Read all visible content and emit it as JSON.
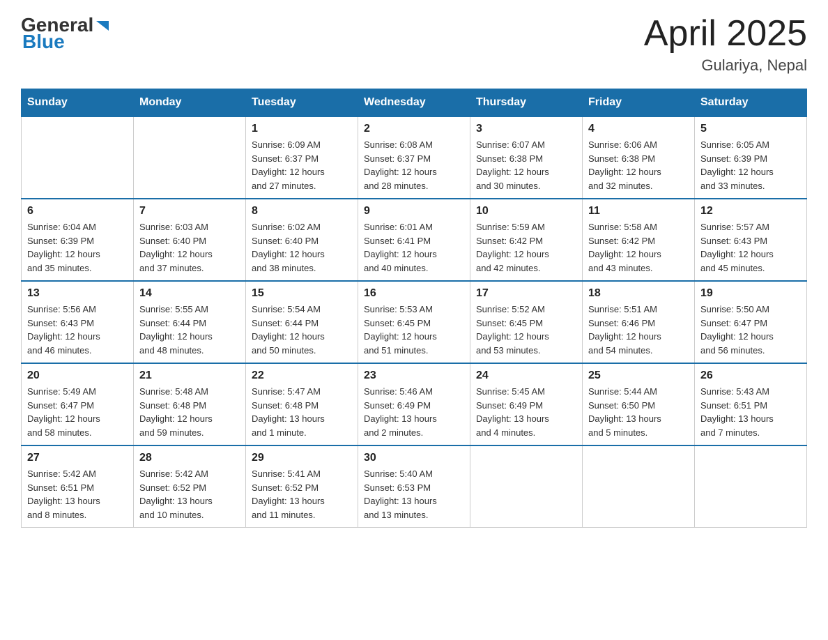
{
  "header": {
    "logo_general": "General",
    "logo_blue": "Blue",
    "month_title": "April 2025",
    "location": "Gulariya, Nepal"
  },
  "weekdays": [
    "Sunday",
    "Monday",
    "Tuesday",
    "Wednesday",
    "Thursday",
    "Friday",
    "Saturday"
  ],
  "weeks": [
    [
      {
        "day": "",
        "info": ""
      },
      {
        "day": "",
        "info": ""
      },
      {
        "day": "1",
        "info": "Sunrise: 6:09 AM\nSunset: 6:37 PM\nDaylight: 12 hours\nand 27 minutes."
      },
      {
        "day": "2",
        "info": "Sunrise: 6:08 AM\nSunset: 6:37 PM\nDaylight: 12 hours\nand 28 minutes."
      },
      {
        "day": "3",
        "info": "Sunrise: 6:07 AM\nSunset: 6:38 PM\nDaylight: 12 hours\nand 30 minutes."
      },
      {
        "day": "4",
        "info": "Sunrise: 6:06 AM\nSunset: 6:38 PM\nDaylight: 12 hours\nand 32 minutes."
      },
      {
        "day": "5",
        "info": "Sunrise: 6:05 AM\nSunset: 6:39 PM\nDaylight: 12 hours\nand 33 minutes."
      }
    ],
    [
      {
        "day": "6",
        "info": "Sunrise: 6:04 AM\nSunset: 6:39 PM\nDaylight: 12 hours\nand 35 minutes."
      },
      {
        "day": "7",
        "info": "Sunrise: 6:03 AM\nSunset: 6:40 PM\nDaylight: 12 hours\nand 37 minutes."
      },
      {
        "day": "8",
        "info": "Sunrise: 6:02 AM\nSunset: 6:40 PM\nDaylight: 12 hours\nand 38 minutes."
      },
      {
        "day": "9",
        "info": "Sunrise: 6:01 AM\nSunset: 6:41 PM\nDaylight: 12 hours\nand 40 minutes."
      },
      {
        "day": "10",
        "info": "Sunrise: 5:59 AM\nSunset: 6:42 PM\nDaylight: 12 hours\nand 42 minutes."
      },
      {
        "day": "11",
        "info": "Sunrise: 5:58 AM\nSunset: 6:42 PM\nDaylight: 12 hours\nand 43 minutes."
      },
      {
        "day": "12",
        "info": "Sunrise: 5:57 AM\nSunset: 6:43 PM\nDaylight: 12 hours\nand 45 minutes."
      }
    ],
    [
      {
        "day": "13",
        "info": "Sunrise: 5:56 AM\nSunset: 6:43 PM\nDaylight: 12 hours\nand 46 minutes."
      },
      {
        "day": "14",
        "info": "Sunrise: 5:55 AM\nSunset: 6:44 PM\nDaylight: 12 hours\nand 48 minutes."
      },
      {
        "day": "15",
        "info": "Sunrise: 5:54 AM\nSunset: 6:44 PM\nDaylight: 12 hours\nand 50 minutes."
      },
      {
        "day": "16",
        "info": "Sunrise: 5:53 AM\nSunset: 6:45 PM\nDaylight: 12 hours\nand 51 minutes."
      },
      {
        "day": "17",
        "info": "Sunrise: 5:52 AM\nSunset: 6:45 PM\nDaylight: 12 hours\nand 53 minutes."
      },
      {
        "day": "18",
        "info": "Sunrise: 5:51 AM\nSunset: 6:46 PM\nDaylight: 12 hours\nand 54 minutes."
      },
      {
        "day": "19",
        "info": "Sunrise: 5:50 AM\nSunset: 6:47 PM\nDaylight: 12 hours\nand 56 minutes."
      }
    ],
    [
      {
        "day": "20",
        "info": "Sunrise: 5:49 AM\nSunset: 6:47 PM\nDaylight: 12 hours\nand 58 minutes."
      },
      {
        "day": "21",
        "info": "Sunrise: 5:48 AM\nSunset: 6:48 PM\nDaylight: 12 hours\nand 59 minutes."
      },
      {
        "day": "22",
        "info": "Sunrise: 5:47 AM\nSunset: 6:48 PM\nDaylight: 13 hours\nand 1 minute."
      },
      {
        "day": "23",
        "info": "Sunrise: 5:46 AM\nSunset: 6:49 PM\nDaylight: 13 hours\nand 2 minutes."
      },
      {
        "day": "24",
        "info": "Sunrise: 5:45 AM\nSunset: 6:49 PM\nDaylight: 13 hours\nand 4 minutes."
      },
      {
        "day": "25",
        "info": "Sunrise: 5:44 AM\nSunset: 6:50 PM\nDaylight: 13 hours\nand 5 minutes."
      },
      {
        "day": "26",
        "info": "Sunrise: 5:43 AM\nSunset: 6:51 PM\nDaylight: 13 hours\nand 7 minutes."
      }
    ],
    [
      {
        "day": "27",
        "info": "Sunrise: 5:42 AM\nSunset: 6:51 PM\nDaylight: 13 hours\nand 8 minutes."
      },
      {
        "day": "28",
        "info": "Sunrise: 5:42 AM\nSunset: 6:52 PM\nDaylight: 13 hours\nand 10 minutes."
      },
      {
        "day": "29",
        "info": "Sunrise: 5:41 AM\nSunset: 6:52 PM\nDaylight: 13 hours\nand 11 minutes."
      },
      {
        "day": "30",
        "info": "Sunrise: 5:40 AM\nSunset: 6:53 PM\nDaylight: 13 hours\nand 13 minutes."
      },
      {
        "day": "",
        "info": ""
      },
      {
        "day": "",
        "info": ""
      },
      {
        "day": "",
        "info": ""
      }
    ]
  ]
}
